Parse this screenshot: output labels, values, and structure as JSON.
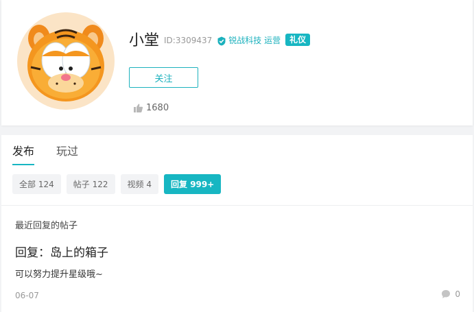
{
  "profile": {
    "name": "小堂",
    "id_text": "ID:3309437",
    "org": "锐战科技 运营",
    "badge": "礼仪",
    "follow_label": "关注",
    "likes": "1680",
    "accent": "#17b6c2"
  },
  "tabs": [
    {
      "label": "发布",
      "active": true
    },
    {
      "label": "玩过",
      "active": false
    }
  ],
  "filters": [
    {
      "label": "全部",
      "count": "124",
      "active": false
    },
    {
      "label": "帖子",
      "count": "122",
      "active": false
    },
    {
      "label": "视频",
      "count": "4",
      "active": false
    },
    {
      "label": "回复",
      "count": "999+",
      "active": true
    }
  ],
  "recent": {
    "section_label": "最近回复的帖子",
    "title": "回复：岛上的箱子",
    "body": "可以努力提升星级哦~",
    "date": "06-07",
    "comment_count": "0"
  }
}
